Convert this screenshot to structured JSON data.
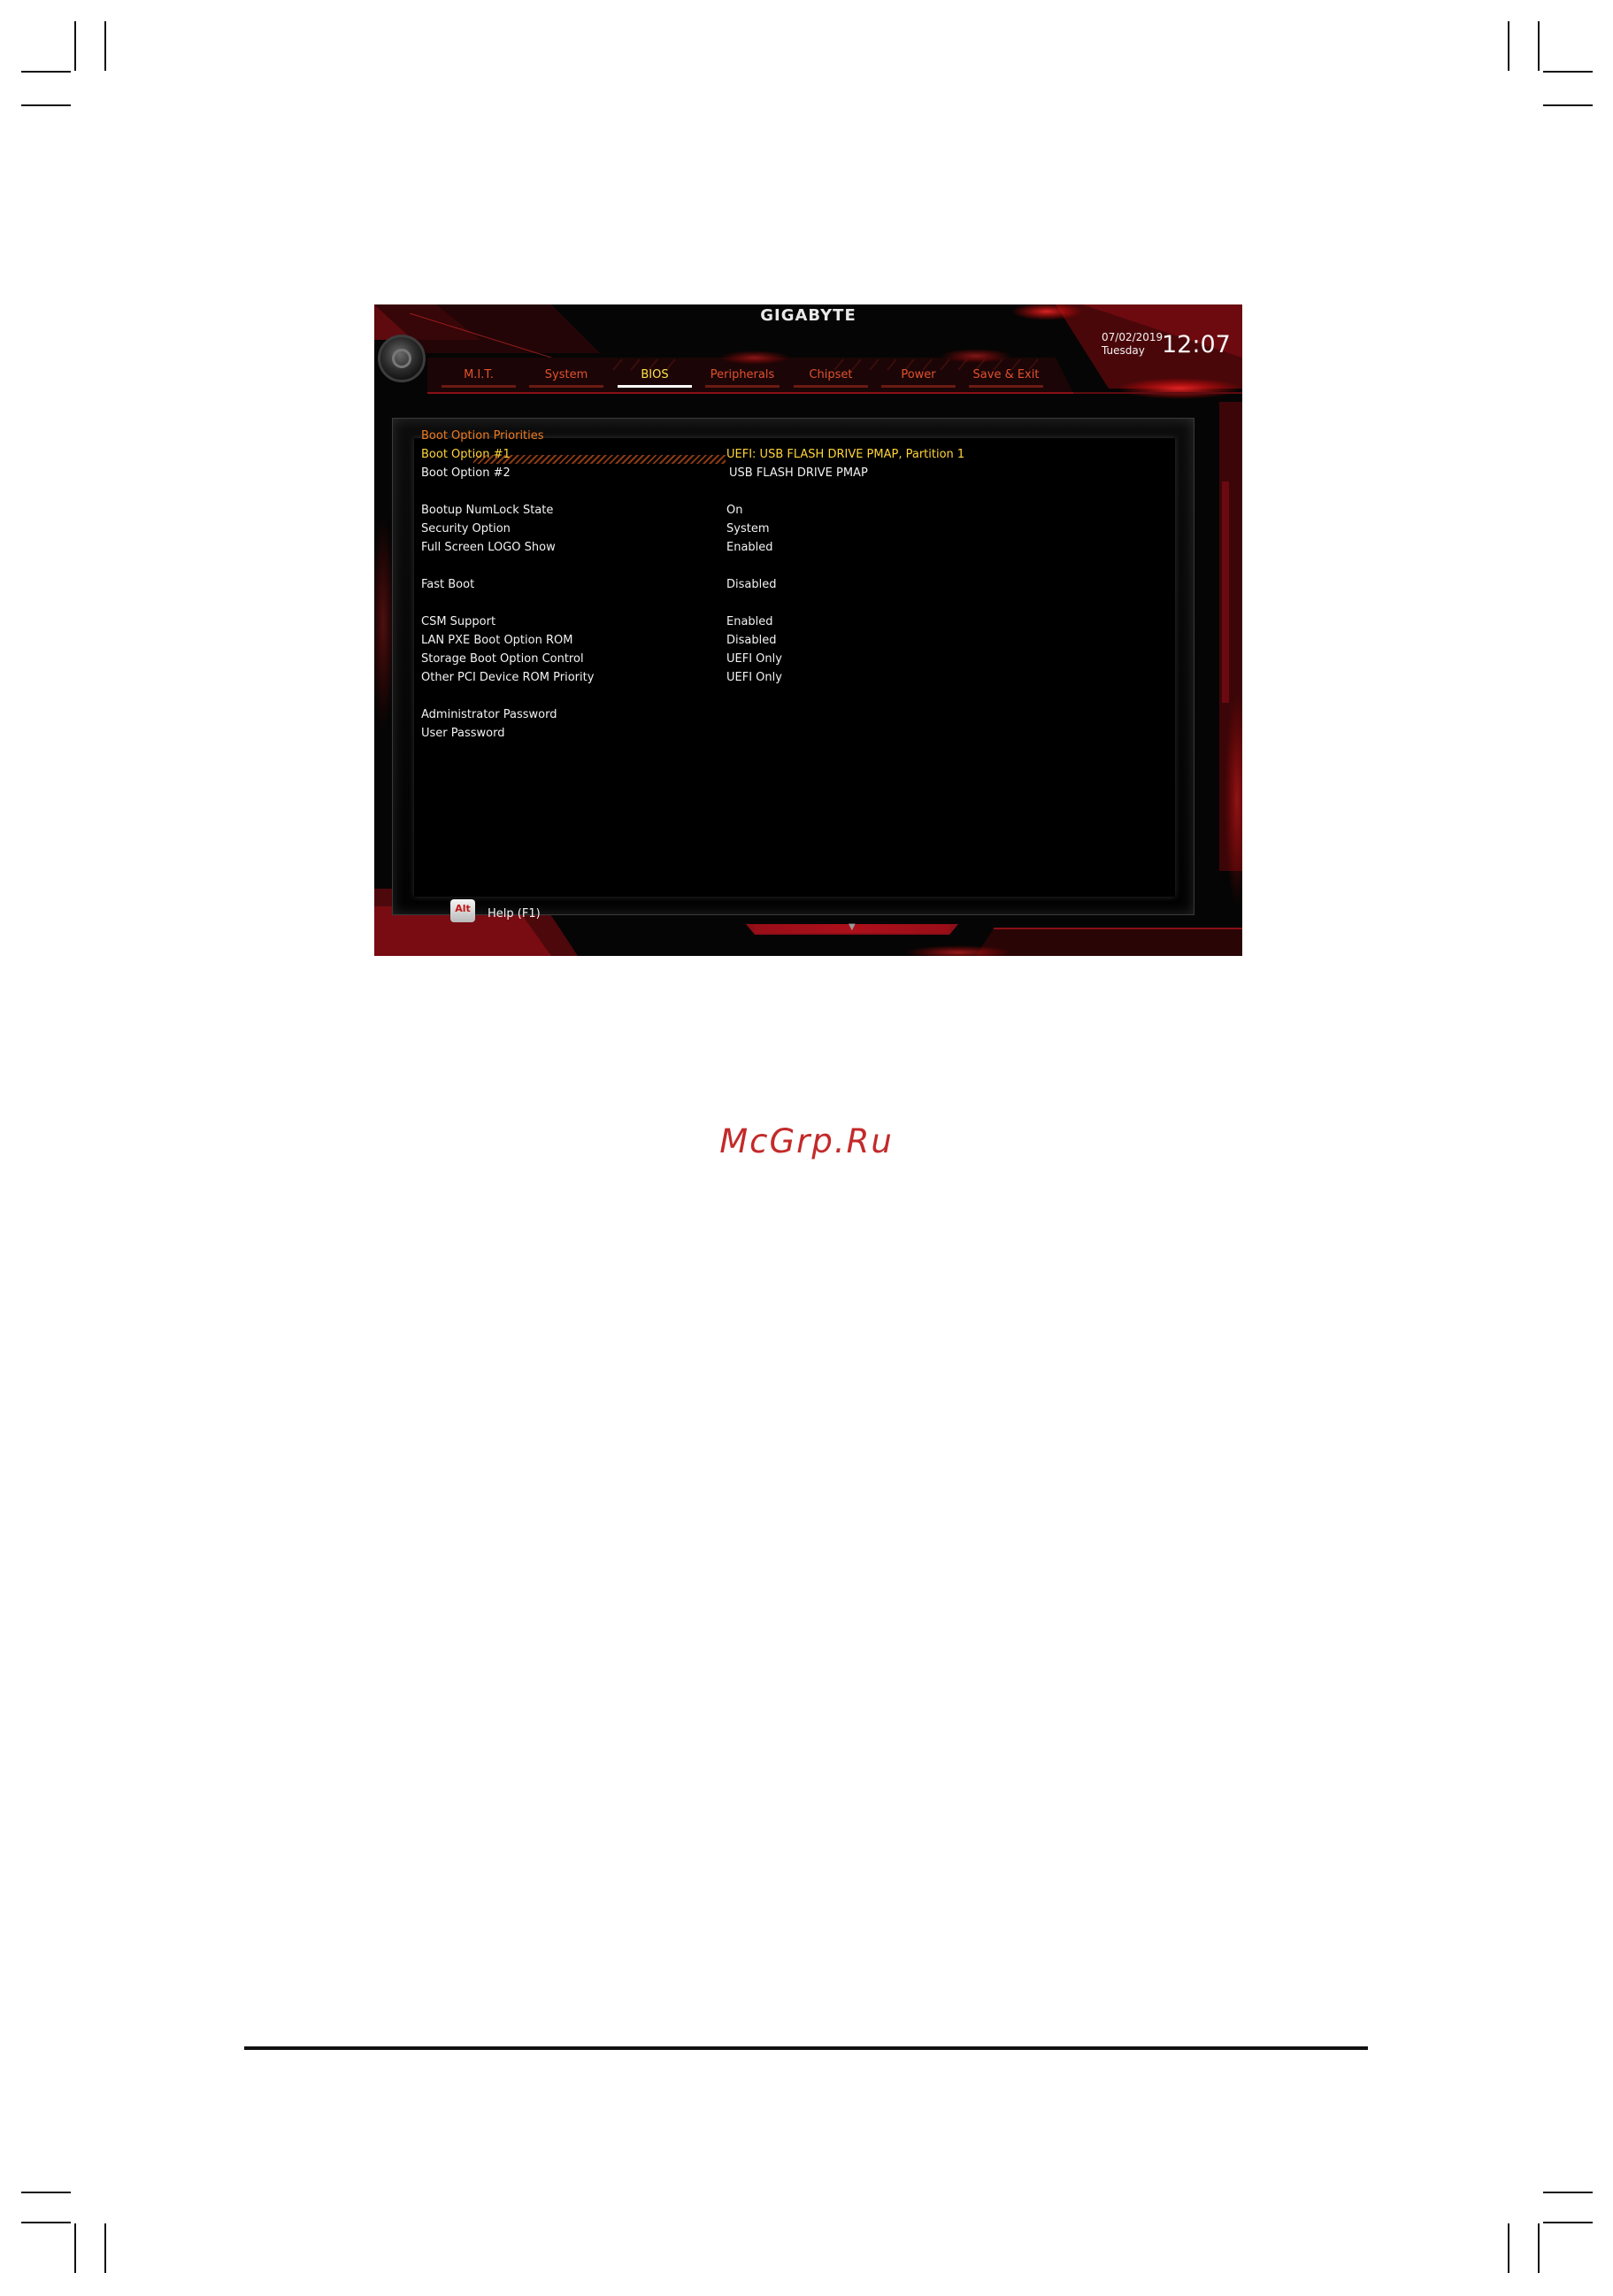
{
  "bios": {
    "brand": "GIGABYTE",
    "date": "07/02/2019",
    "day": "Tuesday",
    "time": "12:07",
    "tabs": [
      {
        "label": "M.I.T.",
        "active": false
      },
      {
        "label": "System",
        "active": false
      },
      {
        "label": "BIOS",
        "active": true
      },
      {
        "label": "Peripherals",
        "active": false
      },
      {
        "label": "Chipset",
        "active": false
      },
      {
        "label": "Power",
        "active": false
      },
      {
        "label": "Save & Exit",
        "active": false
      }
    ],
    "section_title": "Boot Option Priorities",
    "items": [
      {
        "label": "Boot Option #1",
        "value": "UEFI: USB FLASH DRIVE PMAP, Partition 1",
        "selected": true
      },
      {
        "label": "Boot Option #2",
        "value": "USB FLASH DRIVE PMAP"
      },
      {
        "label": "Bootup NumLock State",
        "value": "On"
      },
      {
        "label": "Security Option",
        "value": "System"
      },
      {
        "label": "Full Screen LOGO Show",
        "value": "Enabled"
      },
      {
        "label": "Fast Boot",
        "value": "Disabled"
      },
      {
        "label": "CSM Support",
        "value": "Enabled"
      },
      {
        "label": "LAN PXE Boot Option ROM",
        "value": "Disabled"
      },
      {
        "label": "Storage Boot Option Control",
        "value": "UEFI Only"
      },
      {
        "label": "Other PCI Device ROM Priority",
        "value": "UEFI Only"
      },
      {
        "label": "Administrator Password",
        "value": ""
      },
      {
        "label": "User Password",
        "value": ""
      }
    ],
    "alt_key": "Alt",
    "help_label": "Help (F1)"
  },
  "watermark": "McGrp.Ru",
  "colors": {
    "accent": "#c0101a",
    "selected": "#ffd43a",
    "section": "#f07a1c"
  },
  "icons": [
    "gear-icon",
    "alt-key-icon",
    "scroll-down-arrow-icon"
  ]
}
